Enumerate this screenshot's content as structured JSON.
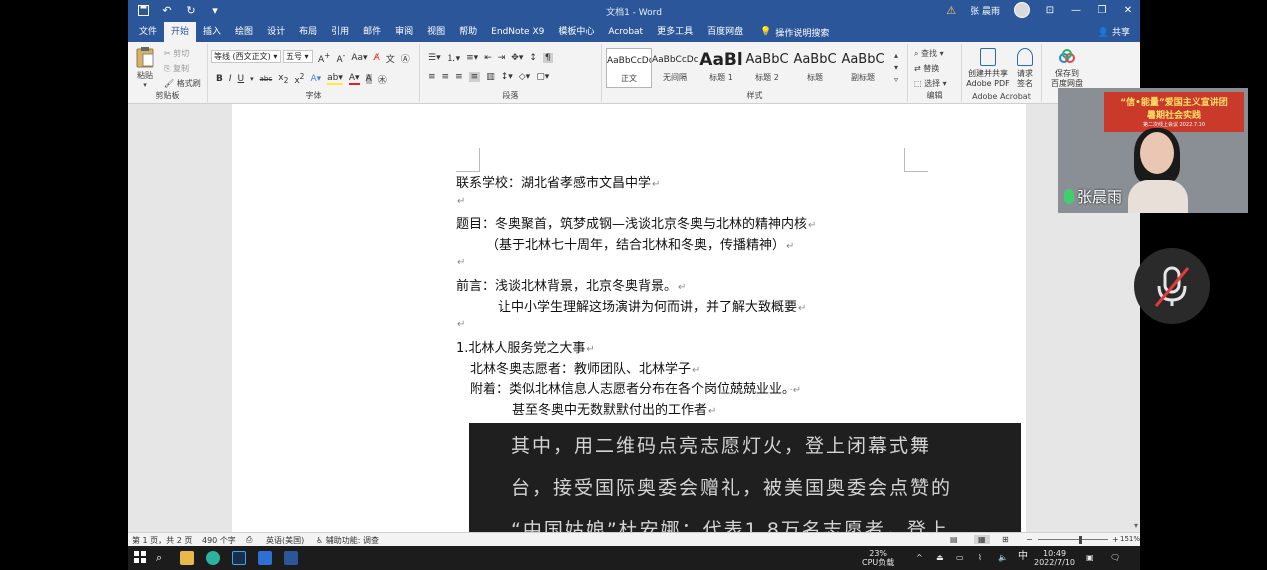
{
  "titlebar": {
    "doc_title": "文档1  -  Word",
    "user_name": "张 晨雨"
  },
  "tabs": [
    "文件",
    "开始",
    "插入",
    "绘图",
    "设计",
    "布局",
    "引用",
    "邮件",
    "审阅",
    "视图",
    "帮助",
    "EndNote X9",
    "模板中心",
    "Acrobat",
    "更多工具",
    "百度网盘"
  ],
  "tell_me": "操作说明搜索",
  "share": "共享",
  "ribbon": {
    "clipboard": {
      "paste": "粘贴",
      "cut": "剪切",
      "copy": "复制",
      "format_painter": "格式刷",
      "label": "剪贴板"
    },
    "font": {
      "font_name": "等线 (西文正文)",
      "font_size": "五号",
      "label": "字体"
    },
    "paragraph": {
      "label": "段落"
    },
    "styles": {
      "items": [
        {
          "sample": "AaBbCcDc",
          "name": "正文"
        },
        {
          "sample": "AaBbCcDc",
          "name": "无间隔"
        },
        {
          "sample": "AaBl",
          "name": "标题 1"
        },
        {
          "sample": "AaBbC",
          "name": "标题 2"
        },
        {
          "sample": "AaBbC",
          "name": "标题"
        },
        {
          "sample": "AaBbC",
          "name": "副标题"
        }
      ],
      "label": "样式"
    },
    "editing": {
      "find": "查找",
      "replace": "替换",
      "select": "选择",
      "label": "编辑"
    },
    "acrobat": {
      "create_share": "创建并共享",
      "create_share2": "Adobe PDF",
      "request_sign": "请求",
      "request_sign2": "签名",
      "label": "Adobe Acrobat"
    },
    "baidu": {
      "save_to": "保存到",
      "save_to2": "百度网盘"
    }
  },
  "document": {
    "lines": [
      "联系学校：湖北省孝感市文昌中学",
      "",
      "题目：冬奥聚首，筑梦成钢—浅谈北京冬奥与北林的精神内核",
      "（基于北林七十周年，结合北林和冬奥，传播精神）",
      "",
      "前言：浅谈北林背景，北京冬奥背景。",
      "让中小学生理解这场演讲为何而讲，并了解大致概要",
      "",
      "1.北林人服务党之大事",
      "北林冬奥志愿者：教师团队、北林学子",
      "附着：类似北林信息人志愿者分布在各个岗位兢兢业业。",
      "甚至冬奥中无数默默付出的工作者"
    ],
    "subtitle_lines": [
      "其中，用二维码点亮志愿灯火，登上闭幕式舞",
      "台，接受国际奥委会赠礼，被美国奥委会点赞的",
      "“中国姑娘”杜安娜；代表1.8万名志愿者，登上"
    ]
  },
  "statusbar": {
    "page": "第 1 页，共 2 页",
    "words": "490 个字",
    "language": "英语(美国)",
    "accessibility": "辅助功能: 调查",
    "zoom": "151%",
    "zoom_level": 0.6
  },
  "webcam": {
    "banner1": "“信•能量”爱国主义宣讲团",
    "banner2": "暑期社会实践",
    "banner3": "第二次线上会议 2022.7.10",
    "name": "张晨雨"
  },
  "taskbar": {
    "cpu": "23%",
    "cpu_label": "CPU负载",
    "ime": "中",
    "time": "10:49",
    "date": "2022/7/10"
  }
}
